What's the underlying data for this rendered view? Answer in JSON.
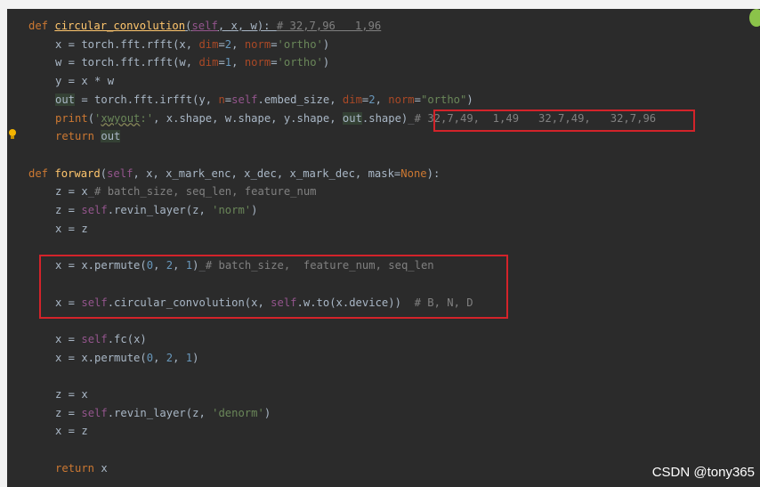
{
  "code": {
    "lines": [
      {
        "indent": 1,
        "tokens": [
          {
            "t": "def ",
            "c": "kw"
          },
          {
            "t": "circular_convolution",
            "c": "fn",
            "u": 1
          },
          {
            "t": "(",
            "c": "plain",
            "u": 1
          },
          {
            "t": "self",
            "c": "self",
            "u": 1
          },
          {
            "t": ", x, w): ",
            "c": "plain",
            "u": 1
          },
          {
            "t": "# 32,7,96   1,96",
            "c": "cmt",
            "u": 1
          }
        ]
      },
      {
        "indent": 2,
        "tokens": [
          {
            "t": "x = torch.fft.rfft(x, ",
            "c": "plain"
          },
          {
            "t": "dim",
            "c": "param"
          },
          {
            "t": "=",
            "c": "plain"
          },
          {
            "t": "2",
            "c": "num"
          },
          {
            "t": ", ",
            "c": "plain"
          },
          {
            "t": "norm",
            "c": "param"
          },
          {
            "t": "=",
            "c": "plain"
          },
          {
            "t": "'ortho'",
            "c": "str"
          },
          {
            "t": ")",
            "c": "plain"
          }
        ]
      },
      {
        "indent": 2,
        "tokens": [
          {
            "t": "w = torch.fft.rfft(w, ",
            "c": "plain"
          },
          {
            "t": "dim",
            "c": "param"
          },
          {
            "t": "=",
            "c": "plain"
          },
          {
            "t": "1",
            "c": "num"
          },
          {
            "t": ", ",
            "c": "plain"
          },
          {
            "t": "norm",
            "c": "param"
          },
          {
            "t": "=",
            "c": "plain"
          },
          {
            "t": "'ortho'",
            "c": "str"
          },
          {
            "t": ")",
            "c": "plain"
          }
        ]
      },
      {
        "indent": 2,
        "tokens": [
          {
            "t": "y = x * w",
            "c": "plain"
          }
        ]
      },
      {
        "indent": 2,
        "tokens": [
          {
            "t": "out",
            "c": "plain",
            "hl": 1
          },
          {
            "t": " = torch.fft.irfft(y, ",
            "c": "plain"
          },
          {
            "t": "n",
            "c": "param"
          },
          {
            "t": "=",
            "c": "plain"
          },
          {
            "t": "self",
            "c": "self"
          },
          {
            "t": ".embed_size, ",
            "c": "plain"
          },
          {
            "t": "dim",
            "c": "param"
          },
          {
            "t": "=",
            "c": "plain"
          },
          {
            "t": "2",
            "c": "num"
          },
          {
            "t": ", ",
            "c": "plain"
          },
          {
            "t": "norm",
            "c": "param"
          },
          {
            "t": "=",
            "c": "plain"
          },
          {
            "t": "\"ortho\"",
            "c": "str"
          },
          {
            "t": ")",
            "c": "plain"
          }
        ]
      },
      {
        "indent": 2,
        "tokens": [
          {
            "t": "print",
            "c": "kw"
          },
          {
            "t": "(",
            "c": "plain"
          },
          {
            "t": "'",
            "c": "str"
          },
          {
            "t": "xwyout",
            "c": "str",
            "w": 1
          },
          {
            "t": ":'",
            "c": "str"
          },
          {
            "t": ", x.shape, w.shape, y.shape, ",
            "c": "plain"
          },
          {
            "t": "out",
            "c": "plain",
            "hl": 1
          },
          {
            "t": ".shape)",
            "c": "plain"
          },
          {
            "t": "_",
            "c": "dim"
          },
          {
            "t": "# ",
            "c": "cmt"
          },
          {
            "t": "32,7,49,  1,49   32,7,49,   32,7,96",
            "c": "cmt"
          }
        ]
      },
      {
        "indent": 2,
        "tokens": [
          {
            "t": "return ",
            "c": "kw"
          },
          {
            "t": "out",
            "c": "plain",
            "hl": 1
          }
        ]
      },
      {
        "indent": 0,
        "tokens": []
      },
      {
        "indent": 1,
        "tokens": [
          {
            "t": "def ",
            "c": "kw"
          },
          {
            "t": "forward",
            "c": "fn"
          },
          {
            "t": "(",
            "c": "plain"
          },
          {
            "t": "self",
            "c": "self"
          },
          {
            "t": ", x, x_mark_enc, x_dec, x_mark_dec, mask=",
            "c": "plain"
          },
          {
            "t": "None",
            "c": "kw"
          },
          {
            "t": "):",
            "c": "plain"
          }
        ]
      },
      {
        "indent": 2,
        "tokens": [
          {
            "t": "z = x",
            "c": "plain"
          },
          {
            "t": "_",
            "c": "dim"
          },
          {
            "t": "# batch_size, seq_len, feature_num",
            "c": "cmt"
          }
        ]
      },
      {
        "indent": 2,
        "tokens": [
          {
            "t": "z = ",
            "c": "plain"
          },
          {
            "t": "self",
            "c": "self"
          },
          {
            "t": ".revin_layer(z, ",
            "c": "plain"
          },
          {
            "t": "'norm'",
            "c": "str"
          },
          {
            "t": ")",
            "c": "plain"
          }
        ]
      },
      {
        "indent": 2,
        "tokens": [
          {
            "t": "x = z",
            "c": "plain"
          }
        ]
      },
      {
        "indent": 0,
        "tokens": []
      },
      {
        "indent": 2,
        "tokens": [
          {
            "t": "x = x.permute(",
            "c": "plain"
          },
          {
            "t": "0",
            "c": "num"
          },
          {
            "t": ", ",
            "c": "plain"
          },
          {
            "t": "2",
            "c": "num"
          },
          {
            "t": ", ",
            "c": "plain"
          },
          {
            "t": "1",
            "c": "num"
          },
          {
            "t": ")",
            "c": "plain"
          },
          {
            "t": "_",
            "c": "dim"
          },
          {
            "t": "# batch_size,  feature_num, seq_len",
            "c": "cmt"
          }
        ]
      },
      {
        "indent": 0,
        "tokens": []
      },
      {
        "indent": 2,
        "tokens": [
          {
            "t": "x = ",
            "c": "plain"
          },
          {
            "t": "self",
            "c": "self"
          },
          {
            "t": ".circular_convolution(x, ",
            "c": "plain"
          },
          {
            "t": "self",
            "c": "self"
          },
          {
            "t": ".w.to(x.device))  ",
            "c": "plain"
          },
          {
            "t": "# B, N, D",
            "c": "cmt"
          }
        ]
      },
      {
        "indent": 0,
        "tokens": []
      },
      {
        "indent": 2,
        "tokens": [
          {
            "t": "x = ",
            "c": "plain"
          },
          {
            "t": "self",
            "c": "self"
          },
          {
            "t": ".fc(x)",
            "c": "plain"
          }
        ]
      },
      {
        "indent": 2,
        "tokens": [
          {
            "t": "x = x.permute(",
            "c": "plain"
          },
          {
            "t": "0",
            "c": "num"
          },
          {
            "t": ", ",
            "c": "plain"
          },
          {
            "t": "2",
            "c": "num"
          },
          {
            "t": ", ",
            "c": "plain"
          },
          {
            "t": "1",
            "c": "num"
          },
          {
            "t": ")",
            "c": "plain"
          }
        ]
      },
      {
        "indent": 0,
        "tokens": []
      },
      {
        "indent": 2,
        "tokens": [
          {
            "t": "z = x",
            "c": "plain"
          }
        ]
      },
      {
        "indent": 2,
        "tokens": [
          {
            "t": "z = ",
            "c": "plain"
          },
          {
            "t": "self",
            "c": "self"
          },
          {
            "t": ".revin_layer(z, ",
            "c": "plain"
          },
          {
            "t": "'denorm'",
            "c": "str"
          },
          {
            "t": ")",
            "c": "plain"
          }
        ]
      },
      {
        "indent": 2,
        "tokens": [
          {
            "t": "x = z",
            "c": "plain"
          }
        ]
      },
      {
        "indent": 0,
        "tokens": []
      },
      {
        "indent": 2,
        "tokens": [
          {
            "t": "return ",
            "c": "kw"
          },
          {
            "t": "x",
            "c": "plain"
          }
        ]
      }
    ]
  },
  "colors": {
    "editor_bg": "#2b2b2b",
    "annotation_box": "#d3232a",
    "keyword": "#cc7832",
    "function": "#ffc66d",
    "self": "#94558d",
    "string": "#6a8759",
    "number": "#6897bb",
    "param": "#aa4926",
    "comment": "#808080"
  },
  "icons": {
    "gutter": "lightbulb-icon",
    "corner": "status-dot-icon"
  },
  "watermark": "CSDN @tony365"
}
